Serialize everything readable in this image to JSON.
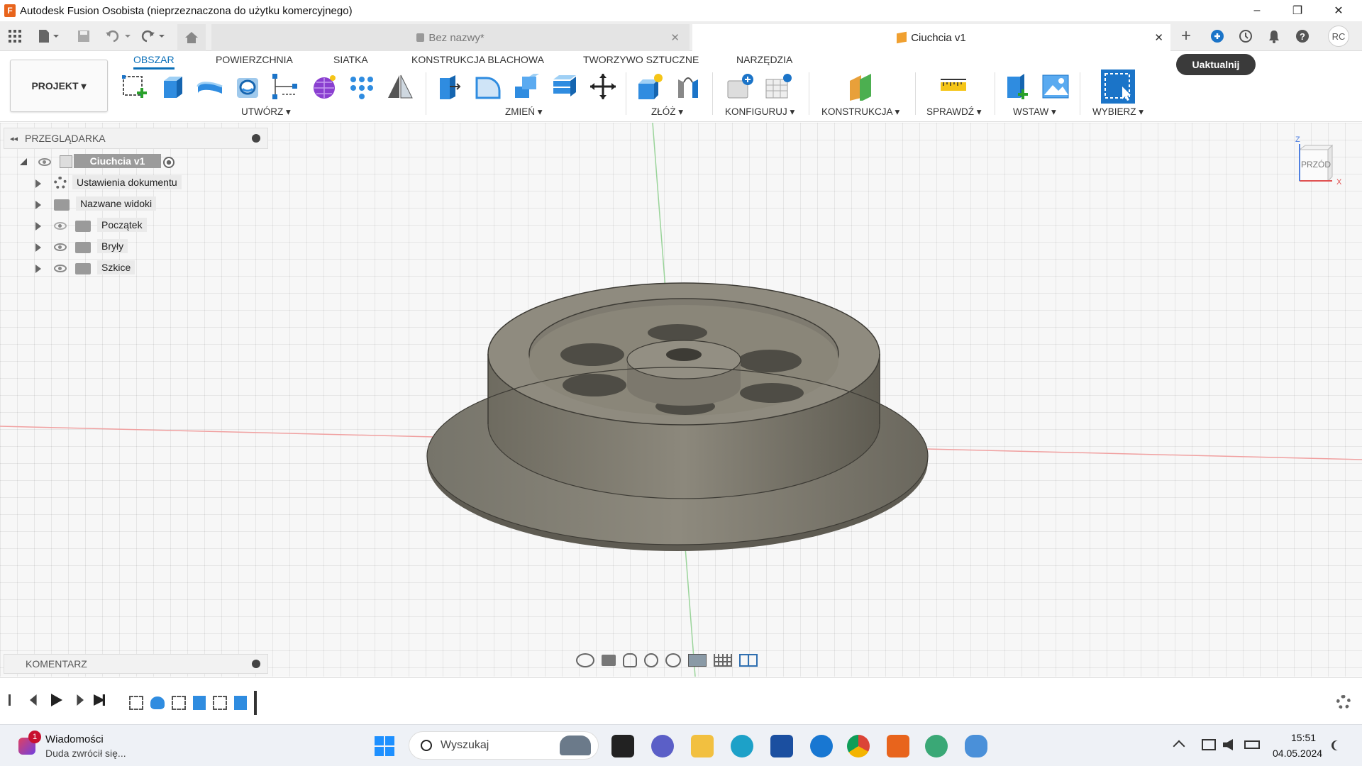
{
  "window": {
    "title": "Autodesk Fusion Osobista (nieprzeznaczona do użytku komercyjnego)",
    "app_badge": "F",
    "minimize_icon": "–",
    "restore_icon": "❐",
    "close_icon": "✕"
  },
  "tabs": {
    "inactive_tab": "Bez nazwy*",
    "active_tab": "Ciuchcia v1",
    "close_glyph": "✕",
    "add_glyph": "+",
    "user_initials": "RC"
  },
  "ribbon": {
    "project_button": "PROJEKT ▾",
    "tabs": [
      "OBSZAR",
      "POWIERZCHNIA",
      "SIATKA",
      "KONSTRUKCJA BLACHOWA",
      "TWORZYWO SZTUCZNE",
      "NARZĘDZIA"
    ],
    "groups": {
      "create": "UTWÓRZ ▾",
      "modify": "ZMIEŃ ▾",
      "assemble": "ZŁÓŻ ▾",
      "configure": "KONFIGURUJ ▾",
      "construct": "KONSTRUKCJA ▾",
      "inspect": "SPRAWDŹ ▾",
      "insert": "WSTAW ▾",
      "select": "WYBIERZ ▾"
    },
    "update_button": "Uaktualnij"
  },
  "browser": {
    "title": "PRZEGLĄDARKA",
    "root": "Ciuchcia v1",
    "items": [
      "Ustawienia dokumentu",
      "Nazwane widoki",
      "Początek",
      "Bryły",
      "Szkice"
    ]
  },
  "viewcube": {
    "face": "PRZÓD",
    "axis_z": "Z",
    "axis_x": "X"
  },
  "comment": {
    "label": "KOMENTARZ"
  },
  "taskbar": {
    "notification_title": "Wiadomości",
    "notification_body": "Duda zwrócił się...",
    "notification_count": "1",
    "search_placeholder": "Wyszukaj",
    "time": "15:51",
    "date": "04.05.2024"
  }
}
